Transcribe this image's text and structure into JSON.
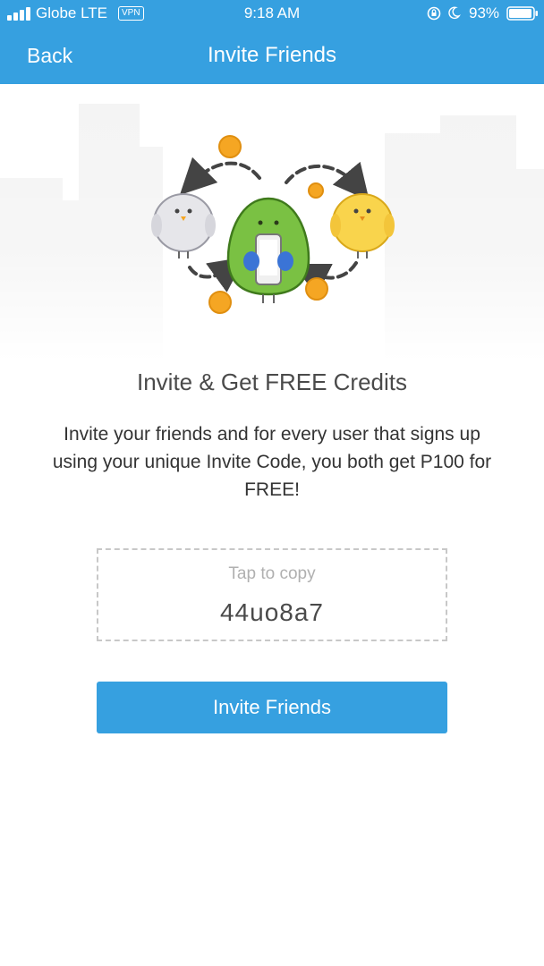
{
  "status_bar": {
    "carrier": "Globe",
    "network": "LTE",
    "vpn_label": "VPN",
    "time": "9:18 AM",
    "battery": "93%",
    "icons": [
      "signal-icon",
      "orientation-lock-icon",
      "moon-icon",
      "battery-icon"
    ]
  },
  "nav": {
    "back_label": "Back",
    "title": "Invite Friends"
  },
  "hero": {
    "illustration": "birds-sharing-coins-illustration"
  },
  "content": {
    "headline": "Invite & Get FREE Credits",
    "description": "Invite your friends and for every user that signs up using your unique Invite Code, you both get P100 for FREE!"
  },
  "invite_code": {
    "hint": "Tap to copy",
    "code": "44uo8a7"
  },
  "actions": {
    "invite_button_label": "Invite Friends"
  },
  "colors": {
    "primary": "#36a0e0",
    "text_dark": "#4a4a4a",
    "coin": "#f5a623",
    "green_bird": "#7ac143",
    "yellow_bird": "#f9d44c"
  }
}
